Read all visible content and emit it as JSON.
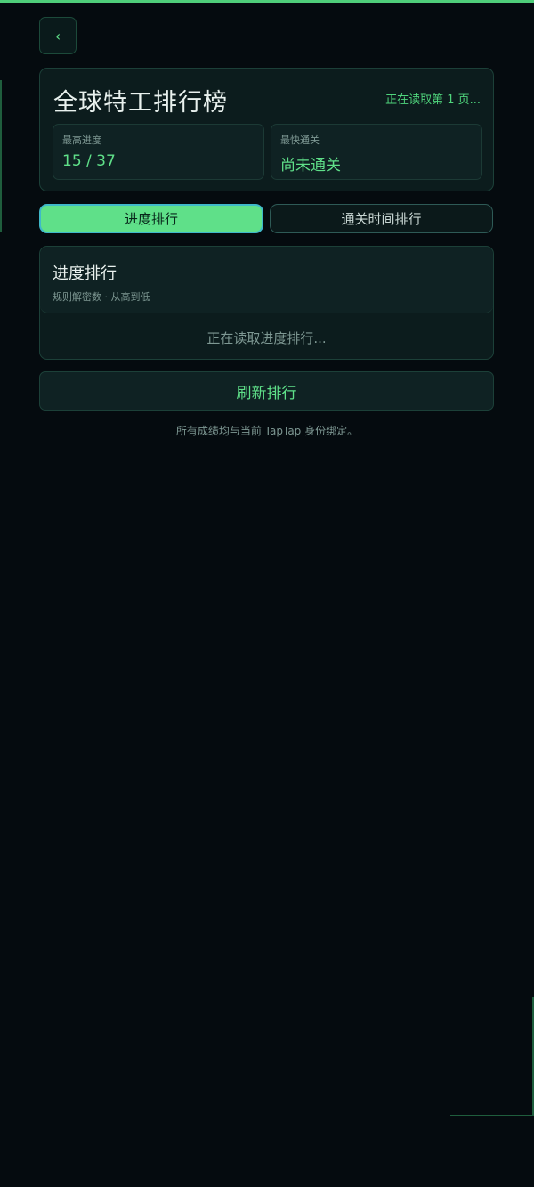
{
  "nav": {
    "back_glyph": "‹",
    "back_icon": "chevron-left-icon"
  },
  "header": {
    "title": "全球特工排行榜",
    "loading_status": "正在读取第 1 页...",
    "stats": {
      "best_progress": {
        "label": "最高进度",
        "value": "15 / 37"
      },
      "fastest_clear": {
        "label": "最快通关",
        "value": "尚未通关"
      }
    }
  },
  "tabs": [
    {
      "label": "进度排行",
      "active": true
    },
    {
      "label": "通关时间排行",
      "active": false
    }
  ],
  "ranking": {
    "title": "进度排行",
    "subtitle": "规则解密数 · 从高到低",
    "loading_text": "正在读取进度排行..."
  },
  "refresh_label": "刷新排行",
  "footnote": "所有成绩均与当前 TapTap 身份绑定。",
  "colors": {
    "accent": "#5fe089",
    "background": "#050b0f",
    "card": "#0c1c1d",
    "border": "#1c4038",
    "muted_text": "#7e9893",
    "primary_text": "#e9f1ee"
  }
}
